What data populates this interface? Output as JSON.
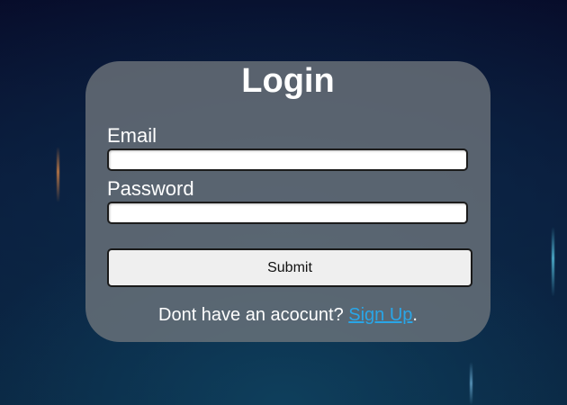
{
  "login": {
    "title": "Login",
    "email_label": "Email",
    "email_value": "",
    "password_label": "Password",
    "password_value": "",
    "submit_label": "Submit",
    "footer_prefix": "Dont have an acocunt? ",
    "signup_link": "Sign Up",
    "footer_suffix": "."
  },
  "colors": {
    "link": "#29a6e8",
    "card": "#70767c",
    "background": "#0a1838"
  }
}
